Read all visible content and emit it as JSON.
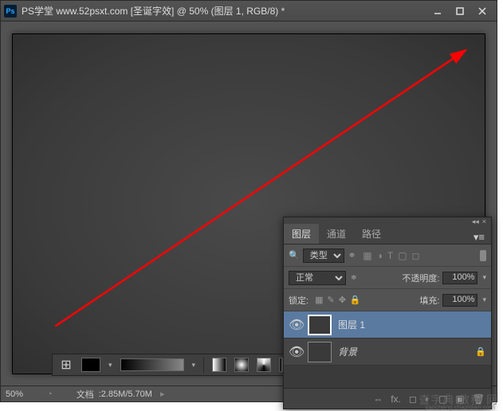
{
  "window": {
    "app_icon": "Ps",
    "title": "PS学堂 www.52psxt.com [圣诞字效] @ 50% (图层 1, RGB/8) *"
  },
  "statusbar": {
    "zoom": "50%",
    "doc_label": "文档",
    "doc_size": ":2.85M/5.70M"
  },
  "panel": {
    "tabs": {
      "layers": "图层",
      "channels": "通道",
      "paths": "路径"
    },
    "filter": {
      "kind_label": "类型",
      "icons": [
        "▦",
        "◑",
        "T",
        "▢",
        "◻"
      ]
    },
    "blend": {
      "mode": "正常",
      "opacity_label": "不透明度:",
      "opacity_value": "100%"
    },
    "lock": {
      "label": "锁定:",
      "fill_label": "填充:",
      "fill_value": "100%"
    },
    "layers": [
      {
        "name": "图层 1",
        "visible": true,
        "active": true,
        "locked": false
      },
      {
        "name": "背景",
        "visible": true,
        "active": false,
        "locked": true
      }
    ]
  },
  "watermark": {
    "main": "查字典 教程 网",
    "sub": "jiaocheng.chazidian.com"
  }
}
